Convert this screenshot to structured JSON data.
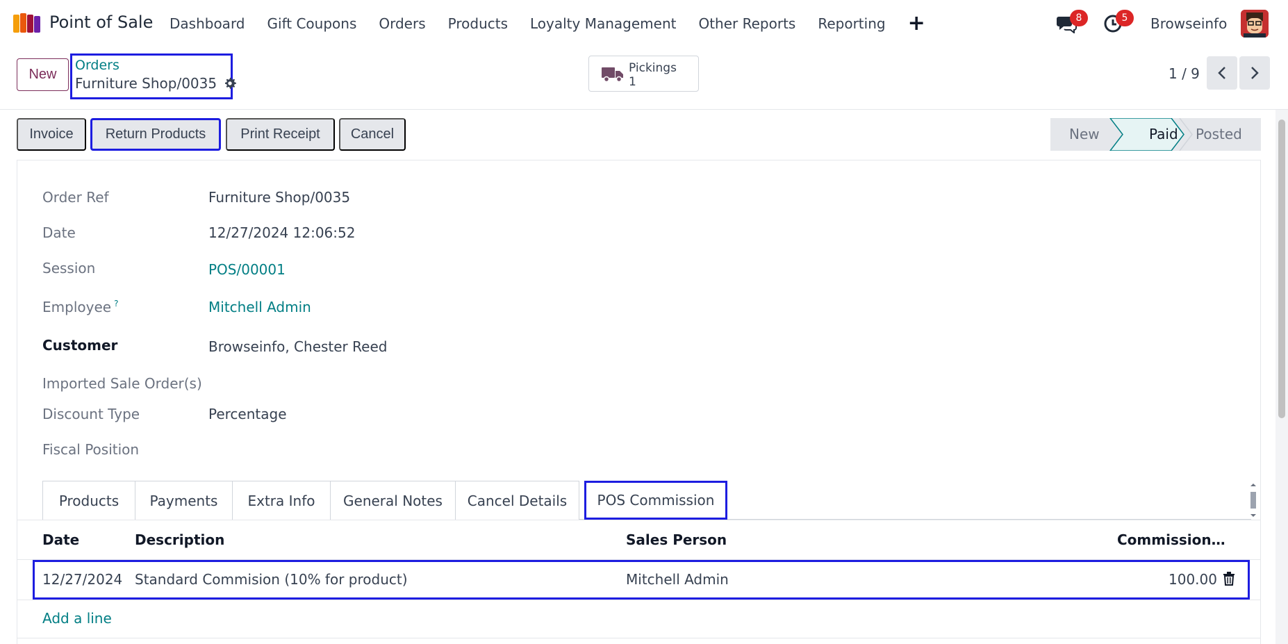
{
  "navbar": {
    "app_name": "Point of Sale",
    "menu": [
      "Dashboard",
      "Gift Coupons",
      "Orders",
      "Products",
      "Loyalty Management",
      "Other Reports",
      "Reporting"
    ],
    "plus": "+",
    "chat_badge": "8",
    "activity_badge": "5",
    "user_name": "Browseinfo"
  },
  "control": {
    "new_label": "New",
    "breadcrumb_parent": "Orders",
    "breadcrumb_current": "Furniture Shop/0035",
    "pickings_label": "Pickings",
    "pickings_count": "1",
    "pager": "1 / 9"
  },
  "actions": {
    "invoice": "Invoice",
    "return_products": "Return Products",
    "print_receipt": "Print Receipt",
    "cancel": "Cancel"
  },
  "status": {
    "steps": [
      "New",
      "Paid",
      "Posted"
    ],
    "current": "Paid"
  },
  "form": {
    "order_ref_label": "Order Ref",
    "order_ref": "Furniture Shop/0035",
    "date_label": "Date",
    "date": "12/27/2024 12:06:52",
    "session_label": "Session",
    "session": "POS/00001",
    "employee_label": "Employee",
    "employee_help": "?",
    "employee": "Mitchell Admin",
    "customer_label": "Customer",
    "customer": "Browseinfo, Chester Reed",
    "imported_label": "Imported Sale Order(s)",
    "discount_label": "Discount Type",
    "discount": "Percentage",
    "fiscal_label": "Fiscal Position"
  },
  "tabs": [
    "Products",
    "Payments",
    "Extra Info",
    "General Notes",
    "Cancel Details",
    "POS Commission"
  ],
  "active_tab": "POS Commission",
  "commission_table": {
    "columns": [
      "Date",
      "Description",
      "Sales Person",
      "Commission…"
    ],
    "rows": [
      {
        "date": "12/27/2024",
        "description": "Standard Commision (10% for product)",
        "sales_person": "Mitchell Admin",
        "commission": "100.00"
      }
    ],
    "add_line": "Add a line"
  },
  "colors": {
    "accent_link": "#017e84",
    "brand": "#714b67",
    "highlight": "#1d1de0",
    "badge": "#dc2626"
  }
}
